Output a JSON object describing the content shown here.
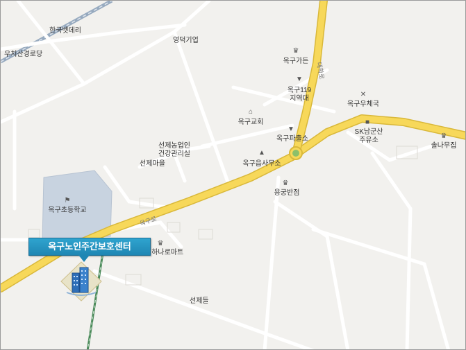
{
  "map": {
    "colors": {
      "background": "#f2f1ee",
      "road_main": "#f7d85a",
      "road_minor": "#ffffff",
      "rail": "#97aabf",
      "school_area": "#c8d3e0",
      "callout": "#1f86b3"
    },
    "labels": {
      "hanguk": "한국벳데리",
      "uchisan": "우치산경로당",
      "yeongdeok": "영덕기업",
      "okgugarden": "옥구가든",
      "fire119_line1": "옥구119",
      "fire119_line2": "지역대",
      "postoffice": "옥구우체국",
      "church": "옥구교회",
      "police": "옥구파출소",
      "sk_line1": "SK남군산",
      "sk_line2": "주유소",
      "pine": "솔나무집",
      "nonghyup_line1": "선제농업인",
      "nonghyup_line2": "건강관리실",
      "seonje_village": "선제마을",
      "eup_office": "옥구읍사무소",
      "yonggong": "용궁반점",
      "school": "옥구초등학교",
      "mart": "영하나로마트",
      "seonje_field": "선제들",
      "okgu_road": "옥구로",
      "daehak_road": "대학로"
    },
    "callout": {
      "title": "옥구노인주간보호센터"
    },
    "icons": {
      "restaurant": "restaurant-icon",
      "fire_station": "fire-station-icon",
      "post_office": "post-office-icon",
      "church": "church-icon",
      "police": "police-icon",
      "gas_station": "gas-station-icon",
      "government": "government-office-icon",
      "school": "school-flag-icon",
      "mart": "shopping-icon",
      "building": "building-icon"
    }
  }
}
